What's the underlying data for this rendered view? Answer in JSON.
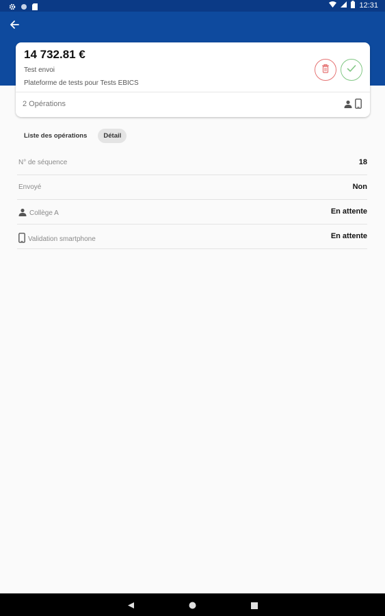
{
  "status_bar": {
    "time": "12:31"
  },
  "card": {
    "amount": "14 732.81 €",
    "title": "Test envoi",
    "subtitle": "Plateforme de tests pour Tests EBICS",
    "operations_count": "2 Opérations"
  },
  "tabs": [
    {
      "label": "Liste des opérations",
      "active": false
    },
    {
      "label": "Détail",
      "active": true
    }
  ],
  "details": [
    {
      "label": "N° de séquence",
      "value": "18",
      "icon": null
    },
    {
      "label": "Envoyé",
      "value": "Non",
      "icon": null
    },
    {
      "label": "Collège A",
      "value": "En attente",
      "icon": "person-icon"
    },
    {
      "label": "Validation smartphone",
      "value": "En attente",
      "icon": "smartphone-icon"
    }
  ],
  "colors": {
    "app_bar": "#0e4a9e",
    "status_bar": "#0b3a86",
    "reject": "#e57373",
    "accept": "#81c784"
  }
}
